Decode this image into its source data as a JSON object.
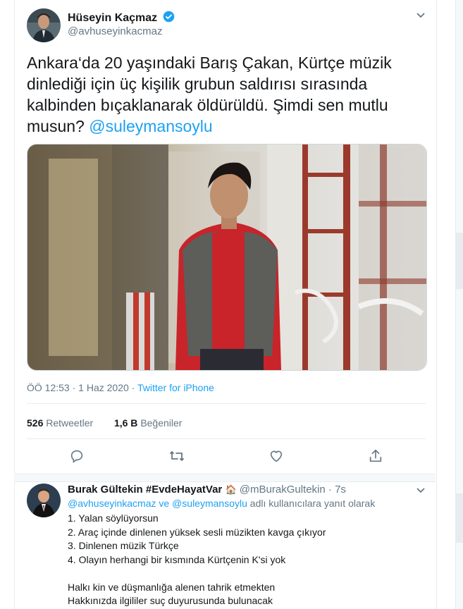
{
  "tweet": {
    "author_name": "Hüseyin Kaçmaz",
    "author_handle": "@avhuseyinkacmaz",
    "text_line1": "Ankara‘da 20 yaşındaki Barış Çakan, Kürtçe müzik",
    "text_line2": "dinlediği için üç kişilik grubun saldırısı sırasında",
    "text_line3": "kalbinden bıçaklanarak öldürüldü. Şimdi sen mutlu",
    "text_line4_prefix": "musun?",
    "text_mention": "@suleymansoylu",
    "time": "ÖÖ 12:53",
    "dot": "·",
    "date": "1 Haz 2020",
    "source": "Twitter for iPhone",
    "retweets_count": "526",
    "retweets_label": "Retweetler",
    "likes_count": "1,6 B",
    "likes_label": "Beğeniler"
  },
  "reply": {
    "author_name": "Burak Gültekin #EvdeHayatVar",
    "house_emoji": "🏠",
    "author_handle": "@mBurakGultekin",
    "dot": "·",
    "age": "7s",
    "mention1": "@avhuseyinkacmaz",
    "and": "ve",
    "mention2": "@suleymansoylu",
    "replying_suffix": "adlı kullanıcılara yanıt olarak",
    "body": "1. Yalan söylüyorsun\n2. Araç içinde dinlenen yüksek sesli müzikten kavga çıkıyor\n3. Dinlenen müzik Türkçe\n4. Olayın herhangi bir kısmında Kürtçenin K'si yok\n\nHalkı kin ve düşmanlığa alenen tahrik etmekten\nHakkınızda ilgililer suç duyurusunda bulunacak"
  },
  "icons": {
    "verified": "verified-badge-icon",
    "chevron": "chevron-down-icon",
    "reply": "reply-icon",
    "retweet": "retweet-icon",
    "like": "heart-icon",
    "share": "share-icon"
  },
  "colors": {
    "accent": "#1da1f2",
    "secondary_text": "#657786",
    "border": "#e6ecf0"
  }
}
